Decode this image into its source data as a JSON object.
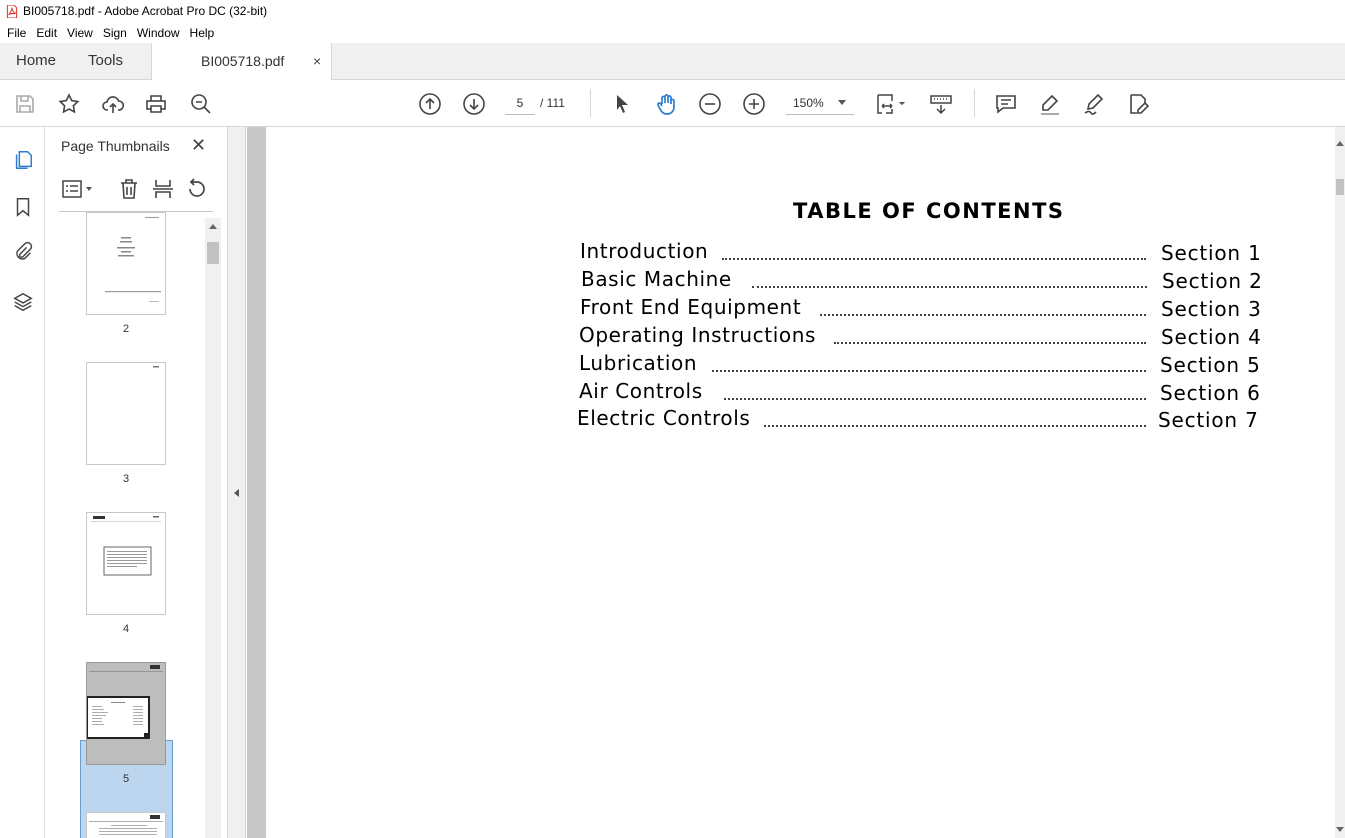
{
  "window": {
    "title": "BI005718.pdf - Adobe Acrobat Pro DC (32-bit)"
  },
  "menu": [
    "File",
    "Edit",
    "View",
    "Sign",
    "Window",
    "Help"
  ],
  "tabs": {
    "home": "Home",
    "tools": "Tools",
    "document": "BI005718.pdf",
    "close": "×"
  },
  "toolbar": {
    "page_current": "5",
    "page_total": "/ 111",
    "zoom": "150%"
  },
  "panel": {
    "title": "Page Thumbnails",
    "close": "✕",
    "thumbnails": [
      {
        "page": "2"
      },
      {
        "page": "3"
      },
      {
        "page": "4"
      },
      {
        "page": "5",
        "selected": true
      }
    ]
  },
  "document": {
    "heading": "TABLE OF CONTENTS",
    "entries": [
      {
        "label": "Introduction",
        "section": "Section 1"
      },
      {
        "label": "Basic Machine",
        "section": "Section 2"
      },
      {
        "label": "Front End Equipment",
        "section": "Section 3"
      },
      {
        "label": "Operating Instructions",
        "section": "Section 4"
      },
      {
        "label": "Lubrication",
        "section": "Section 5"
      },
      {
        "label": "Air Controls",
        "section": "Section 6"
      },
      {
        "label": "Electric Controls",
        "section": "Section 7"
      }
    ]
  },
  "icons": {
    "accent": "#2d7dd2",
    "pdf_icon_color": "#d9241c"
  }
}
